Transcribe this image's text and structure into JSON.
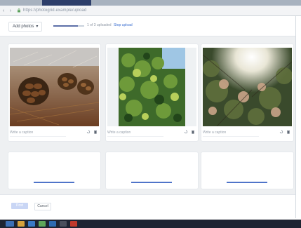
{
  "browser": {
    "url": "https://photogrid.example/upload",
    "nav": {
      "back": "‹",
      "forward": "›"
    }
  },
  "toolbar": {
    "select_label": "Add photos",
    "select_caret": "▾",
    "progress_fraction": 0.8,
    "progress_text": "1 of 3 uploaded",
    "progress_link": "Stop upload"
  },
  "photos": [
    {
      "badge": "",
      "caption_placeholder": "Write a caption",
      "subject": "pine cones"
    },
    {
      "badge": "",
      "caption_placeholder": "Write a caption",
      "subject": "green foliage"
    },
    {
      "badge": "",
      "caption_placeholder": "Write a caption",
      "subject": "sunlit branches"
    }
  ],
  "footer": {
    "primary_label": "Post",
    "secondary_label": "Cancel"
  },
  "colors": {
    "accent": "#4f74c9",
    "progress": "#5c6fa8"
  },
  "icons": [
    "back-icon",
    "forward-icon",
    "lock-icon",
    "rotate-icon",
    "trash-icon"
  ]
}
